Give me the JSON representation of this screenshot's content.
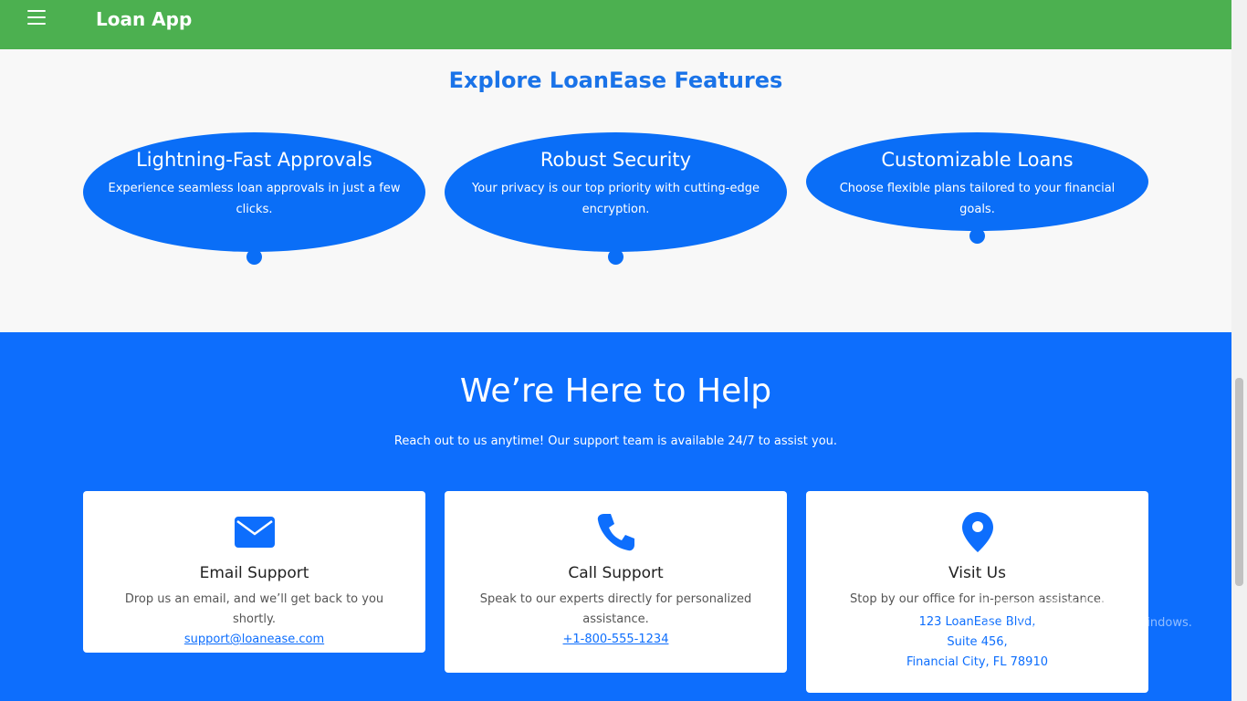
{
  "navbar": {
    "brand": "Loan App",
    "menu_icon": "hamburger-icon"
  },
  "features": {
    "title": "Explore LoanEase Features",
    "items": [
      {
        "title": "Lightning-Fast Approvals",
        "text": "Experience seamless loan approvals in just a few clicks."
      },
      {
        "title": "Robust Security",
        "text": "Your privacy is our top priority with cutting-edge encryption."
      },
      {
        "title": "Customizable Loans",
        "text": "Choose flexible plans tailored to your financial goals."
      }
    ]
  },
  "help": {
    "title": "We’re Here to Help",
    "subtitle": "Reach out to us anytime! Our support team is available 24/7 to assist you.",
    "cards": [
      {
        "icon": "envelope-icon",
        "title": "Email Support",
        "text": "Drop us an email, and we’ll get back to you shortly.",
        "link": "support@loanease.com"
      },
      {
        "icon": "phone-icon",
        "title": "Call Support",
        "text": "Speak to our experts directly for personalized assistance.",
        "link": "+1-800-555-1234"
      },
      {
        "icon": "map-pin-icon",
        "title": "Visit Us",
        "text": "Stop by our office for in-person assistance.",
        "address": [
          "123 LoanEase Blvd,",
          "Suite 456,",
          "Financial City, FL 78910"
        ]
      }
    ]
  },
  "watermark": {
    "line1": "Activate Windows",
    "line2": "Go to Settings to activate Windows."
  },
  "colors": {
    "navbar": "#4cb050",
    "primary": "#0d6efd",
    "bubble": "#0a6ef7",
    "title": "#1a73e8"
  }
}
